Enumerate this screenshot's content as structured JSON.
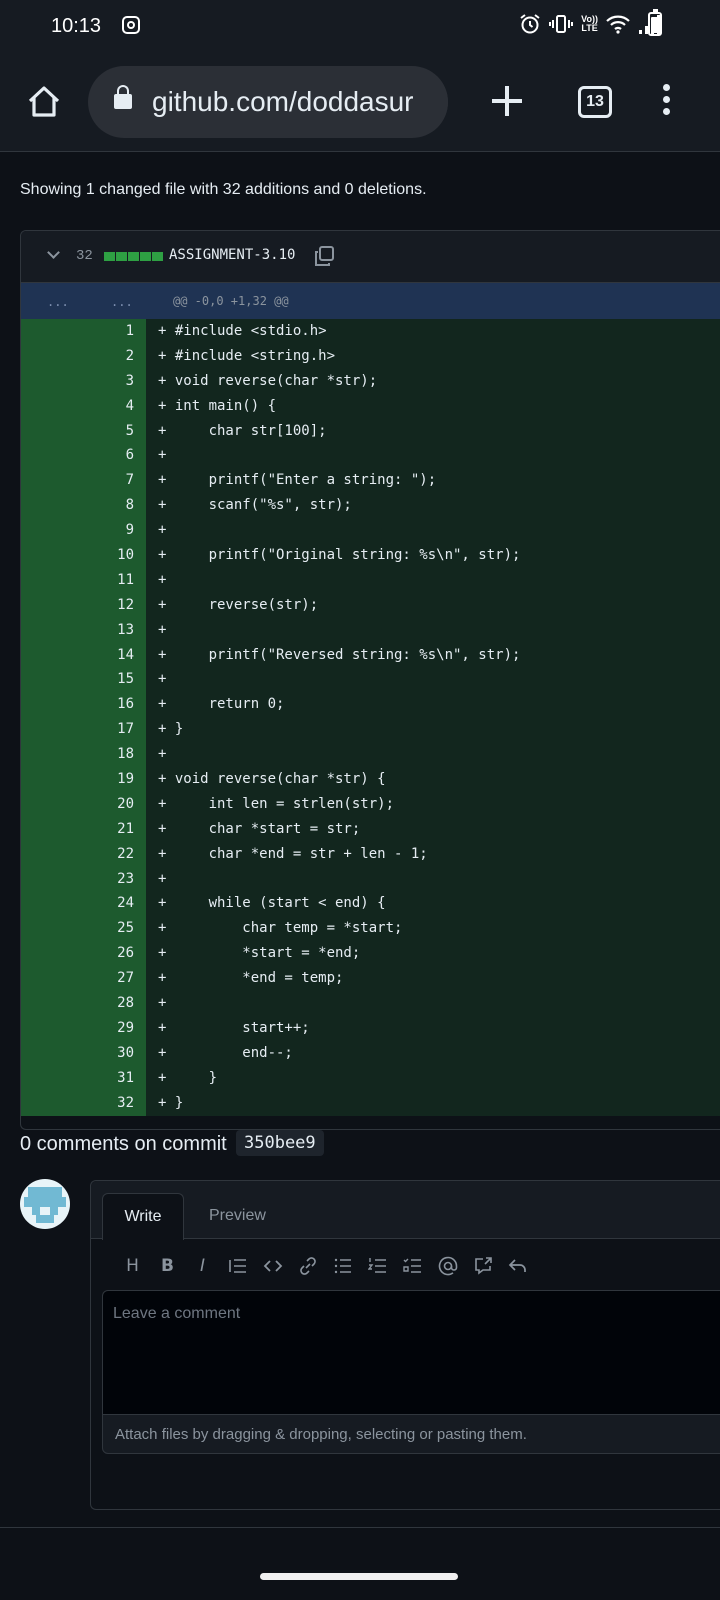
{
  "status_bar": {
    "time": "10:13",
    "volte_label_1": "Vo))",
    "volte_label_2": "LTE",
    "icons": [
      "instagram-icon",
      "alarm-icon",
      "vibrate-icon",
      "volte-icon",
      "wifi-icon",
      "signal-icon",
      "battery-icon"
    ]
  },
  "browser": {
    "url": "github.com/doddasur",
    "tab_count": "13"
  },
  "diff": {
    "summary": "Showing 1 changed file with 32 additions and 0 deletions.",
    "additions": "32",
    "file_name": "ASSIGNMENT-3.10",
    "hunk_dots_left": "...",
    "hunk_dots_right": "...",
    "hunk_header": "@@ -0,0 +1,32 @@",
    "lines": [
      "#include <stdio.h>",
      "#include <string.h>",
      "void reverse(char *str);",
      "int main() {",
      "    char str[100];",
      "",
      "    printf(\"Enter a string: \");",
      "    scanf(\"%s\", str);",
      "",
      "    printf(\"Original string: %s\\n\", str);",
      "",
      "    reverse(str);",
      "",
      "    printf(\"Reversed string: %s\\n\", str);",
      "",
      "    return 0;",
      "}",
      "",
      "void reverse(char *str) {",
      "    int len = strlen(str);",
      "    char *start = str;",
      "    char *end = str + len - 1;",
      "",
      "    while (start < end) {",
      "        char temp = *start;",
      "        *start = *end;",
      "        *end = temp;",
      "",
      "        start++;",
      "        end--;",
      "    }",
      "}"
    ]
  },
  "comments": {
    "title": "0 comments on commit",
    "commit_sha": "350bee9",
    "tab_write": "Write",
    "tab_preview": "Preview",
    "toolbar": [
      "H",
      "B",
      "I"
    ],
    "placeholder": "Leave a comment",
    "attach_text": "Attach files by dragging & dropping, selecting or pasting them."
  },
  "colors": {
    "background": "#0d1117",
    "addition_line_number_bg": "#1d5a2e",
    "addition_code_bg": "#12261e",
    "hunk_bg": "#1f3353",
    "diffstat_green": "#2ea043"
  }
}
